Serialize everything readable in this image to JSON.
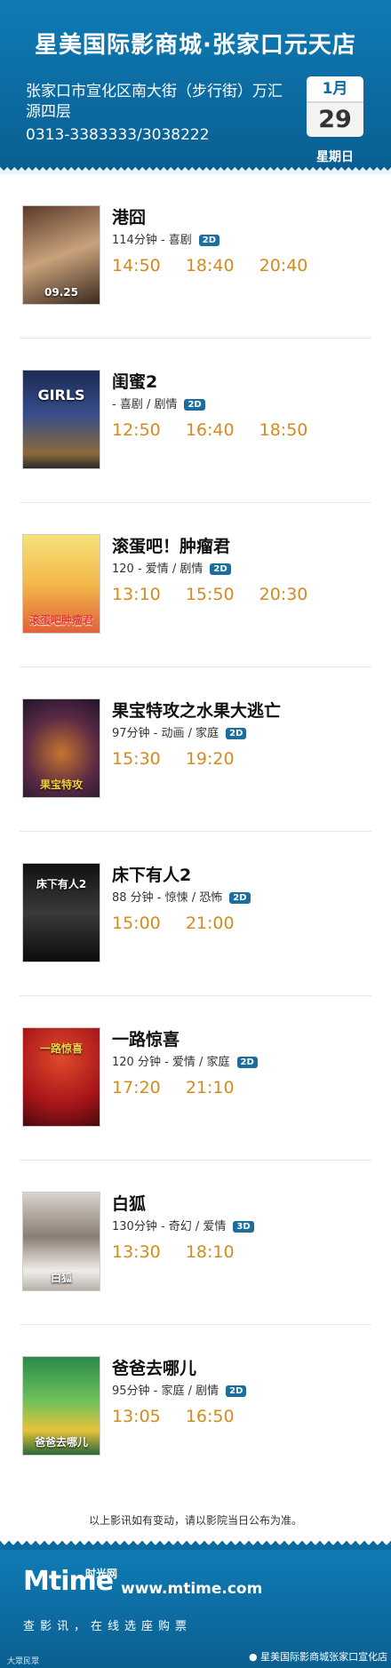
{
  "header": {
    "title": "星美国际影商城·张家口元天店",
    "address": "张家口市宣化区南大街（步行街）万汇源四层",
    "phone": "0313-3383333/3038222",
    "calendar": {
      "month": "1月",
      "day": "29",
      "weekday": "星期日"
    }
  },
  "movies": [
    {
      "name": "港囧",
      "meta": "114分钟 - 喜剧",
      "format": "2D",
      "times": [
        "14:50",
        "18:40",
        "20:40"
      ],
      "poster_caption": "09.25"
    },
    {
      "name": "闺蜜2",
      "meta": "- 喜剧 / 剧情",
      "format": "2D",
      "times": [
        "12:50",
        "16:40",
        "18:50"
      ],
      "poster_caption": "GIRLS"
    },
    {
      "name": "滚蛋吧！肿瘤君",
      "meta": "120 - 爱情 / 剧情",
      "format": "2D",
      "times": [
        "13:10",
        "15:50",
        "20:30"
      ],
      "poster_caption": "滚蛋吧肿瘤君"
    },
    {
      "name": "果宝特攻之水果大逃亡",
      "meta": "97分钟 - 动画 / 家庭",
      "format": "2D",
      "times": [
        "15:30",
        "19:20"
      ],
      "poster_caption": "果宝特攻"
    },
    {
      "name": "床下有人2",
      "meta": "88 分钟 - 惊悚 / 恐怖",
      "format": "2D",
      "times": [
        "15:00",
        "21:00"
      ],
      "poster_caption": "床下有人2"
    },
    {
      "name": "一路惊喜",
      "meta": "120 分钟 - 爱情 / 家庭",
      "format": "2D",
      "times": [
        "17:20",
        "21:10"
      ],
      "poster_caption": "一路惊喜"
    },
    {
      "name": "白狐",
      "meta": "130分钟 - 奇幻 / 爱情",
      "format": "3D",
      "times": [
        "13:30",
        "18:10"
      ],
      "poster_caption": "白狐"
    },
    {
      "name": "爸爸去哪儿",
      "meta": "95分钟 - 家庭 / 剧情",
      "format": "2D",
      "times": [
        "13:05",
        "16:50"
      ],
      "poster_caption": "爸爸去哪儿"
    }
  ],
  "notice": "以上影讯如有变动，请以影院当日公布为准。",
  "footer": {
    "logo": "Mtime",
    "logo_cn": "时光网",
    "site": "www.mtime.com",
    "slogan": "查影讯，在线选座购票",
    "account": "星美国际影商城张家口宣化店",
    "watermark": "大眾民眾"
  },
  "colors": {
    "header_blue": "#0b6aa0",
    "time_orange": "#d38b1f",
    "badge_blue": "#1c6e9d"
  }
}
